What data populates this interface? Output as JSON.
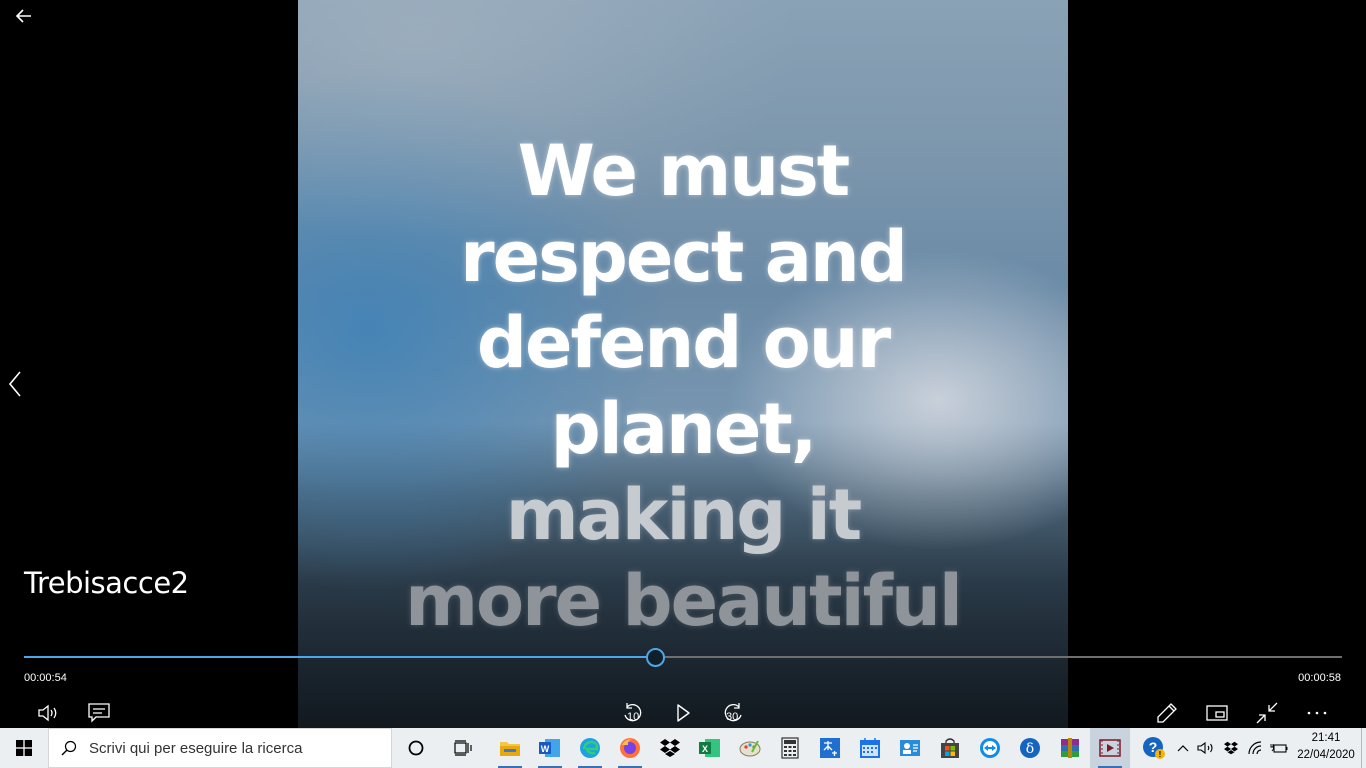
{
  "player": {
    "video_title": "Trebisacce2",
    "quote_lines": [
      "We must",
      "respect and",
      "defend our",
      "planet,",
      "making it",
      "more beautiful"
    ],
    "current_time": "00:00:54",
    "total_time": "00:00:58",
    "progress": 0.4787,
    "skip_back_label": "10",
    "skip_forward_label": "30",
    "accent_color": "#4aa8e8",
    "icons": {
      "back": "back-arrow-icon",
      "prev": "chevron-left-icon",
      "volume": "volume-icon",
      "captions": "captions-icon",
      "skip_back": "skip-back-10-icon",
      "play": "play-icon",
      "skip_forward": "skip-forward-30-icon",
      "edit": "pencil-icon",
      "mini_view": "mini-view-icon",
      "exit_fullscreen": "exit-fullscreen-icon",
      "more": "more-icon"
    }
  },
  "taskbar": {
    "search_placeholder": "Scrivi qui per eseguire la ricerca",
    "clock_time": "21:41",
    "clock_date": "22/04/2020",
    "apps": [
      "cortana-icon",
      "task-view-icon",
      "file-explorer-icon",
      "word-icon",
      "edge-icon",
      "firefox-icon",
      "dropbox-icon",
      "excel-icon",
      "paint-icon",
      "calculator-icon",
      "translator-icon",
      "calendar-icon",
      "contacts-icon",
      "store-icon",
      "teamviewer-icon",
      "delta-icon",
      "winrar-icon",
      "media-player-icon"
    ],
    "tray": [
      "help-icon",
      "show-hidden-icons-chevron",
      "speaker-icon",
      "dropbox-tray-icon",
      "wifi-icon",
      "battery-icon"
    ]
  }
}
